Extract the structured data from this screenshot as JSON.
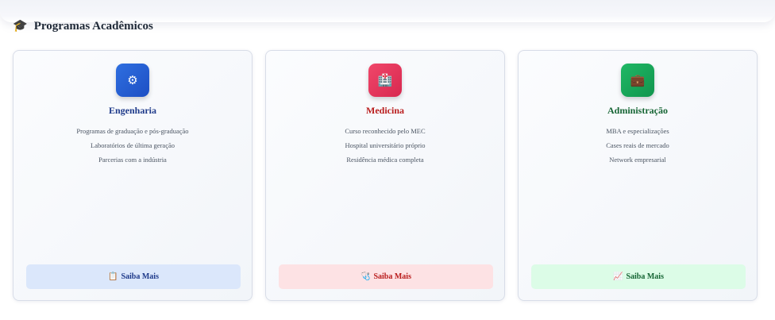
{
  "section": {
    "icon": "graduation-cap-icon",
    "title": "Programas Acadêmicos"
  },
  "programs": [
    {
      "icon": "gear-icon",
      "icon_glyph": "⚙",
      "title": "Engenharia",
      "features": [
        "Programas de graduação e pós-graduação",
        "Laboratórios de última geração",
        "Parcerias com a indústria"
      ],
      "cta_icon": "clipboard-icon",
      "cta_glyph": "📋",
      "cta_label": "Saiba Mais",
      "accent": "#1e3a8a"
    },
    {
      "icon": "hospital-icon",
      "icon_glyph": "🏥",
      "title": "Medicina",
      "features": [
        "Curso reconhecido pelo MEC",
        "Hospital universitário próprio",
        "Residência médica completa"
      ],
      "cta_icon": "stethoscope-icon",
      "cta_glyph": "🩺",
      "cta_label": "Saiba Mais",
      "accent": "#b91c1c"
    },
    {
      "icon": "briefcase-icon",
      "icon_glyph": "💼",
      "title": "Administração",
      "features": [
        "MBA e especializações",
        "Cases reais de mercado",
        "Network empresarial"
      ],
      "cta_icon": "chart-up-icon",
      "cta_glyph": "📈",
      "cta_label": "Saiba Mais",
      "accent": "#166534"
    }
  ]
}
